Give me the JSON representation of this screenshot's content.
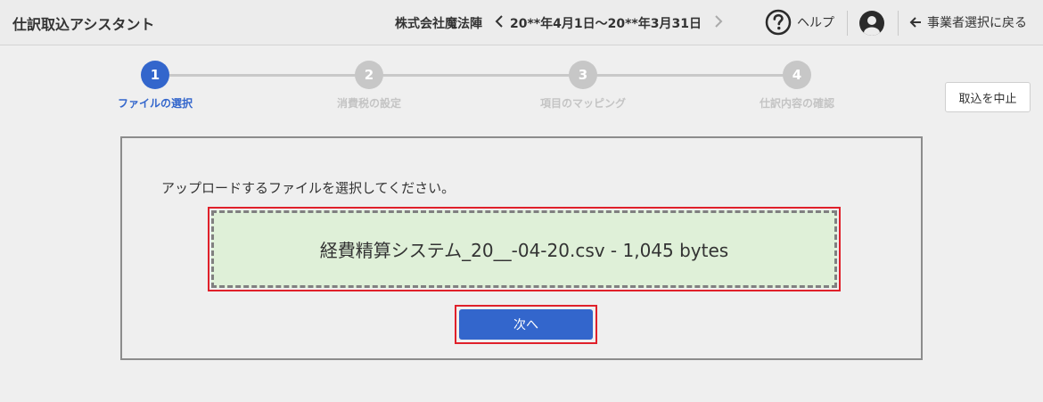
{
  "header": {
    "app_title": "仕訳取込アシスタント",
    "company": "株式会社魔法陣",
    "period": "20**年4月1日〜20**年3月31日",
    "help_label": "ヘルプ",
    "back_label": "事業者選択に戻る"
  },
  "stepper": {
    "steps": [
      {
        "number": "1",
        "label": "ファイルの選択",
        "active": true
      },
      {
        "number": "2",
        "label": "消費税の設定",
        "active": false
      },
      {
        "number": "3",
        "label": "項目のマッピング",
        "active": false
      },
      {
        "number": "4",
        "label": "仕訳内容の確認",
        "active": false
      }
    ]
  },
  "actions": {
    "abort_label": "取込を中止",
    "next_label": "次へ"
  },
  "upload": {
    "instruction": "アップロードするファイルを選択してください。",
    "file_text": "経費精算システム_20__-04-20.csv - 1,045 bytes"
  },
  "colors": {
    "accent": "#3366cc",
    "highlight": "#e0202a",
    "drop_bg": "#dff0d8",
    "inactive_step": "#c7c7c7"
  },
  "icons": {
    "period_prev": "chevron-left-icon",
    "period_next": "chevron-right-icon",
    "help": "question-circle-icon",
    "avatar": "user-circle-icon",
    "back": "arrow-left-icon"
  }
}
